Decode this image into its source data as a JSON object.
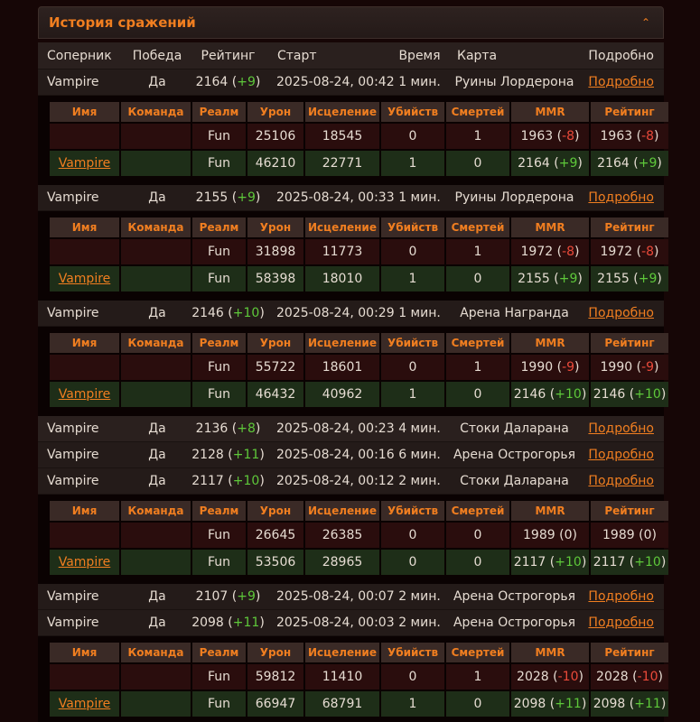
{
  "panel": {
    "title": "История сражений"
  },
  "columns": {
    "opponent": "Соперник",
    "win": "Победа",
    "rating": "Рейтинг",
    "start": "Старт",
    "time": "Время",
    "map": "Карта",
    "details": "Подробно"
  },
  "detail_columns": [
    "Имя",
    "Команда",
    "Реалм",
    "Урон",
    "Исцеление",
    "Убийств",
    "Смертей",
    "MMR",
    "Рейтинг"
  ],
  "link_label": "Подробно",
  "matches": [
    {
      "opponent": "Vampire",
      "win": "Да",
      "rating": "2164",
      "delta": "+9",
      "start": "2025-08-24, 00:42",
      "time": "1 мин.",
      "map": "Руины Лордерона",
      "details": {
        "loser": {
          "name": "",
          "team": "",
          "realm": "Fun",
          "damage": "25106",
          "healing": "18545",
          "kills": "0",
          "deaths": "1",
          "mmr": "1963",
          "mmr_delta": "-8",
          "rating": "1963",
          "rating_delta": "-8"
        },
        "winner": {
          "name": "Vampire",
          "team": "",
          "realm": "Fun",
          "damage": "46210",
          "healing": "22771",
          "kills": "1",
          "deaths": "0",
          "mmr": "2164",
          "mmr_delta": "+9",
          "rating": "2164",
          "rating_delta": "+9"
        }
      }
    },
    {
      "opponent": "Vampire",
      "win": "Да",
      "rating": "2155",
      "delta": "+9",
      "start": "2025-08-24, 00:33",
      "time": "1 мин.",
      "map": "Руины Лордерона",
      "details": {
        "loser": {
          "name": "",
          "team": "",
          "realm": "Fun",
          "damage": "31898",
          "healing": "11773",
          "kills": "0",
          "deaths": "1",
          "mmr": "1972",
          "mmr_delta": "-8",
          "rating": "1972",
          "rating_delta": "-8"
        },
        "winner": {
          "name": "Vampire",
          "team": "",
          "realm": "Fun",
          "damage": "58398",
          "healing": "18010",
          "kills": "1",
          "deaths": "0",
          "mmr": "2155",
          "mmr_delta": "+9",
          "rating": "2155",
          "rating_delta": "+9"
        }
      }
    },
    {
      "opponent": "Vampire",
      "win": "Да",
      "rating": "2146",
      "delta": "+10",
      "start": "2025-08-24, 00:29",
      "time": "1 мин.",
      "map": "Арена Награнда",
      "details": {
        "loser": {
          "name": "",
          "team": "",
          "realm": "Fun",
          "damage": "55722",
          "healing": "18601",
          "kills": "0",
          "deaths": "1",
          "mmr": "1990",
          "mmr_delta": "-9",
          "rating": "1990",
          "rating_delta": "-9"
        },
        "winner": {
          "name": "Vampire",
          "team": "",
          "realm": "Fun",
          "damage": "46432",
          "healing": "40962",
          "kills": "1",
          "deaths": "0",
          "mmr": "2146",
          "mmr_delta": "+10",
          "rating": "2146",
          "rating_delta": "+10"
        }
      }
    },
    {
      "opponent": "Vampire",
      "win": "Да",
      "rating": "2136",
      "delta": "+8",
      "start": "2025-08-24, 00:23",
      "time": "4 мин.",
      "map": "Стоки Даларана"
    },
    {
      "opponent": "Vampire",
      "win": "Да",
      "rating": "2128",
      "delta": "+11",
      "start": "2025-08-24, 00:16",
      "time": "6 мин.",
      "map": "Арена Острогорья"
    },
    {
      "opponent": "Vampire",
      "win": "Да",
      "rating": "2117",
      "delta": "+10",
      "start": "2025-08-24, 00:12",
      "time": "2 мин.",
      "map": "Стоки Даларана",
      "details": {
        "loser": {
          "name": "",
          "team": "",
          "realm": "Fun",
          "damage": "26645",
          "healing": "26385",
          "kills": "0",
          "deaths": "0",
          "mmr": "1989",
          "mmr_delta": "0",
          "rating": "1989",
          "rating_delta": "0"
        },
        "winner": {
          "name": "Vampire",
          "team": "",
          "realm": "Fun",
          "damage": "53506",
          "healing": "28965",
          "kills": "0",
          "deaths": "0",
          "mmr": "2117",
          "mmr_delta": "+10",
          "rating": "2117",
          "rating_delta": "+10"
        }
      }
    },
    {
      "opponent": "Vampire",
      "win": "Да",
      "rating": "2107",
      "delta": "+9",
      "start": "2025-08-24, 00:07",
      "time": "2 мин.",
      "map": "Арена Острогорья"
    },
    {
      "opponent": "Vampire",
      "win": "Да",
      "rating": "2098",
      "delta": "+11",
      "start": "2025-08-24, 00:03",
      "time": "2 мин.",
      "map": "Арена Острогорья",
      "details": {
        "loser": {
          "name": "",
          "team": "",
          "realm": "Fun",
          "damage": "59812",
          "healing": "11410",
          "kills": "0",
          "deaths": "1",
          "mmr": "2028",
          "mmr_delta": "-10",
          "rating": "2028",
          "rating_delta": "-10"
        },
        "winner": {
          "name": "Vampire",
          "team": "",
          "realm": "Fun",
          "damage": "66947",
          "healing": "68791",
          "kills": "1",
          "deaths": "0",
          "mmr": "2098",
          "mmr_delta": "+11",
          "rating": "2098",
          "rating_delta": "+11"
        }
      }
    }
  ],
  "colors": {
    "accent": "#f07e20",
    "positive": "#5ec83a",
    "negative": "#ea4a3a",
    "background": "#160606"
  }
}
